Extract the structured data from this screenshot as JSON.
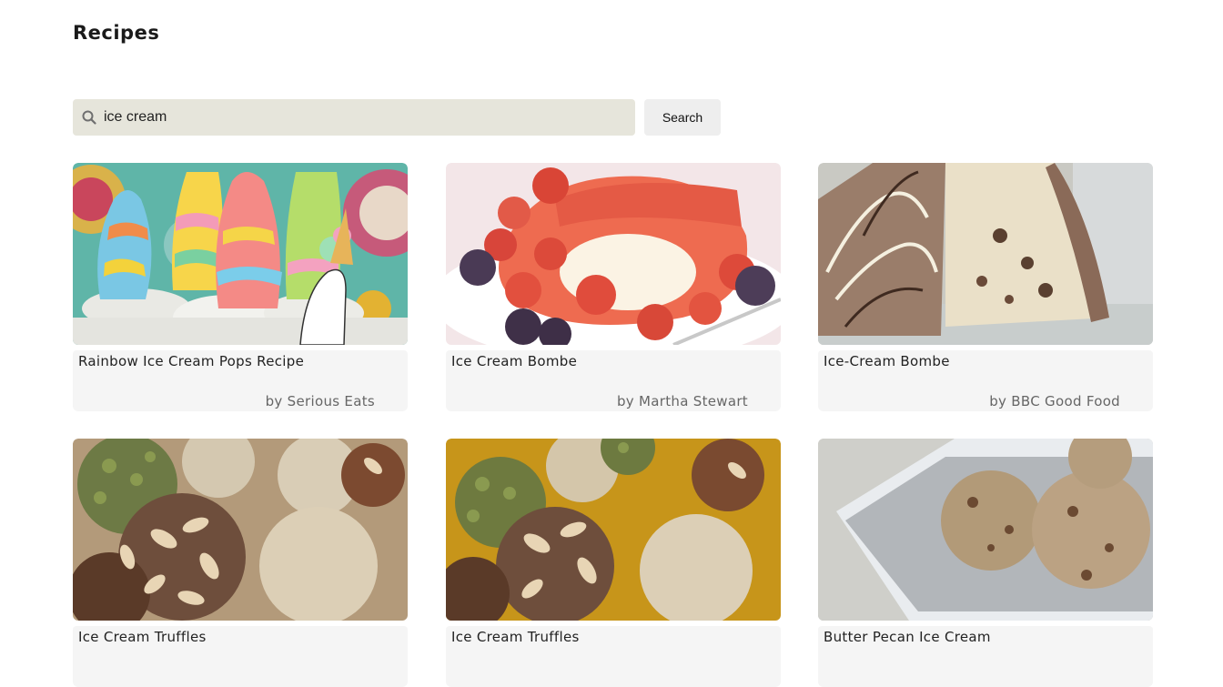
{
  "page": {
    "title": "Recipes"
  },
  "search": {
    "value": "ice cream",
    "button_label": "Search"
  },
  "recipes": [
    {
      "title": "Rainbow Ice Cream Pops Recipe",
      "source": "by Serious Eats",
      "image": "rainbow-ice-cream-pops-photo"
    },
    {
      "title": "Ice Cream Bombe",
      "source": "by Martha Stewart",
      "image": "raspberry-bombe-photo"
    },
    {
      "title": "Ice-Cream Bombe",
      "source": "by BBC Good Food",
      "image": "chocolate-bombe-photo"
    },
    {
      "title": "Ice Cream Truffles",
      "source": "",
      "image": "truffles-photo"
    },
    {
      "title": "Ice Cream Truffles",
      "source": "",
      "image": "truffles-photo"
    },
    {
      "title": "Butter Pecan Ice Cream",
      "source": "",
      "image": "butter-pecan-photo"
    }
  ],
  "colors": {
    "search_bg": "#e6e5db",
    "button_bg": "#eeeeee",
    "card_info_bg": "#f5f5f5"
  }
}
